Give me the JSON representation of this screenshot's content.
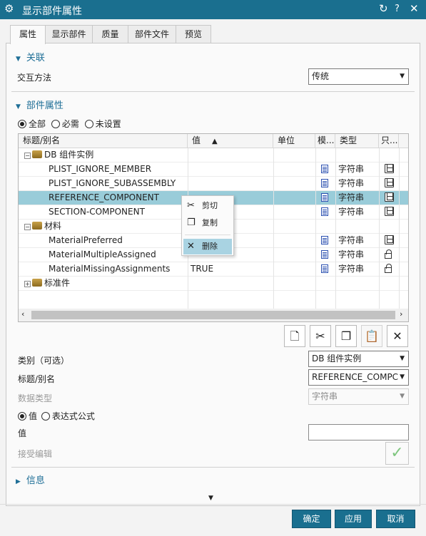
{
  "window": {
    "title": "显示部件属性"
  },
  "tabs": [
    {
      "label": "属性",
      "active": true
    },
    {
      "label": "显示部件"
    },
    {
      "label": "质量"
    },
    {
      "label": "部件文件"
    },
    {
      "label": "预览"
    }
  ],
  "association": {
    "section_label": "关联",
    "method_label": "交互方法",
    "method_value": "传统"
  },
  "part_attributes": {
    "section_label": "部件属性",
    "filter_options": [
      "全部",
      "必需",
      "未设置"
    ],
    "filter_selected": "全部"
  },
  "table": {
    "columns": [
      "标题/别名",
      "值",
      "单位",
      "模...",
      "类型",
      "只..."
    ],
    "sort_indicator": "▲",
    "rows": [
      {
        "indent": 0,
        "expander": "−",
        "icon": "package-icon",
        "title": "DB 组件实例",
        "value": "",
        "type": "",
        "group": true
      },
      {
        "indent": 1,
        "title": "PLIST_IGNORE_MEMBER",
        "value": "",
        "type": "字符串",
        "readonly_icon": "save-icon"
      },
      {
        "indent": 1,
        "title": "PLIST_IGNORE_SUBASSEMBLY",
        "value": "",
        "type": "字符串",
        "readonly_icon": "save-icon"
      },
      {
        "indent": 1,
        "title": "REFERENCE_COMPONENT",
        "value": "",
        "type": "字符串",
        "readonly_icon": "save-icon",
        "selected": true
      },
      {
        "indent": 1,
        "title": "SECTION-COMPONENT",
        "value": "",
        "type": "字符串",
        "readonly_icon": "save-icon"
      },
      {
        "indent": 0,
        "expander": "−",
        "icon": "package-icon",
        "title": "材料",
        "value": "",
        "type": "",
        "group": true
      },
      {
        "indent": 1,
        "title": "MaterialPreferred",
        "value": "",
        "type": "字符串",
        "readonly_icon": "save-icon"
      },
      {
        "indent": 1,
        "title": "MaterialMultipleAssigned",
        "value": "",
        "type": "字符串",
        "readonly_icon": "lock-icon"
      },
      {
        "indent": 1,
        "title": "MaterialMissingAssignments",
        "value": "TRUE",
        "type": "字符串",
        "readonly_icon": "lock-icon"
      },
      {
        "indent": 0,
        "expander": "+",
        "icon": "package-icon",
        "title": "标准件",
        "value": "",
        "type": "",
        "group": true
      }
    ]
  },
  "context_menu": {
    "items": [
      {
        "label": "剪切",
        "icon": "scissors-icon"
      },
      {
        "label": "复制",
        "icon": "copy-icon"
      },
      {
        "label": "删除",
        "icon": "delete-icon",
        "highlighted": true
      }
    ]
  },
  "form": {
    "category_label": "类别（可选）",
    "category_value": "DB 组件实例",
    "title_label": "标题/别名",
    "title_value": "REFERENCE_COMPC",
    "datatype_label": "数据类型",
    "datatype_value": "字符串",
    "value_mode_options": [
      "值",
      "表达式公式"
    ],
    "value_mode_selected": "值",
    "value_label": "值",
    "value_value": "",
    "accept_edit_label": "接受编辑"
  },
  "info": {
    "section_label": "信息"
  },
  "buttons": {
    "ok": "确定",
    "apply": "应用",
    "cancel": "取消"
  },
  "colors": {
    "accent": "#1a6f8f",
    "selection": "#99ccd9",
    "section_text": "#1f6f97"
  }
}
